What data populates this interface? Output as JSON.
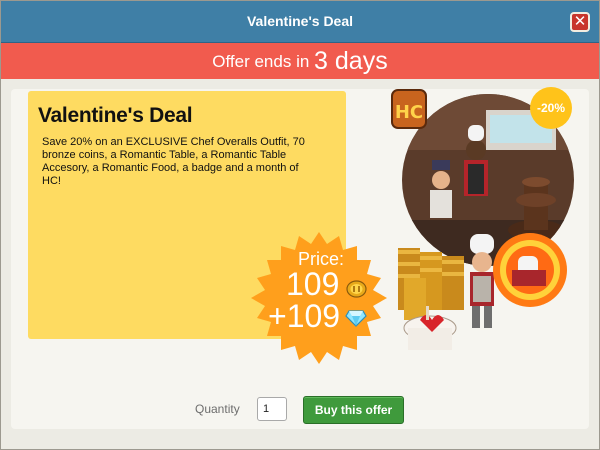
{
  "window": {
    "title": "Valentine's Deal",
    "close_icon": "close-icon"
  },
  "offer_bar": {
    "prefix": "Offer ends in",
    "time": "3 days"
  },
  "deal": {
    "title": "Valentine's Deal",
    "description": "Save 20% on an EXCLUSIVE Chef Overalls Outfit, 70 bronze coins, a Romantic Table, a Romantic Table Accesory, a Romantic Food, a badge and a month of HC!",
    "discount": "-20%",
    "hc_badge": "HC"
  },
  "price": {
    "label": "Price:",
    "coins": "109",
    "diamonds": "+109",
    "coin_icon": "coin-icon",
    "diamond_icon": "diamond-icon"
  },
  "purchase": {
    "quantity_label": "Quantity",
    "quantity_value": "1",
    "buy_label": "Buy this offer"
  },
  "colors": {
    "titlebar": "#3f7fa6",
    "offer_bar": "#f15b4e",
    "panel": "#fedb61",
    "badge": "#ff8c1a",
    "buy_button": "#3f9a3c"
  }
}
